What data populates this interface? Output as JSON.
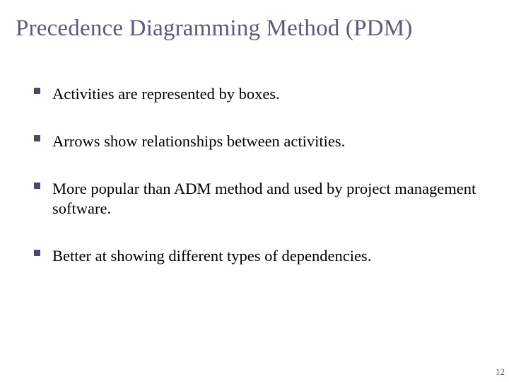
{
  "slide": {
    "title": "Precedence Diagramming Method (PDM)",
    "bullets": [
      "Activities are represented by boxes.",
      "Arrows show relationships between activities.",
      "More popular than ADM method and used by project management software.",
      "Better at showing different types of dependencies."
    ],
    "page_number": "12"
  }
}
